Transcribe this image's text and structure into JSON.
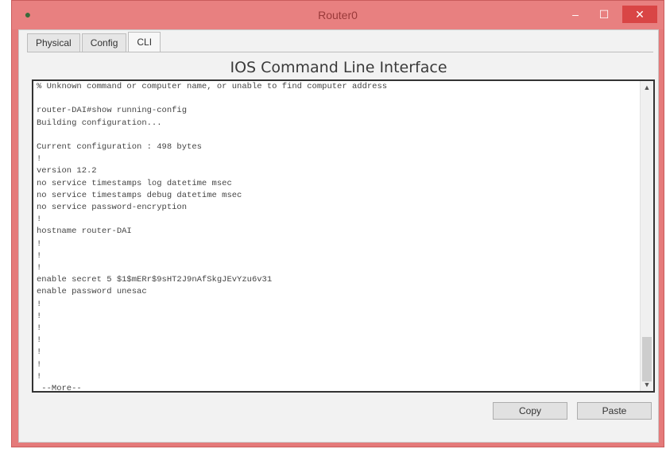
{
  "window": {
    "title": "Router0",
    "controls": {
      "minimize": "–",
      "maximize": "☐",
      "close": "✕"
    }
  },
  "tabs": [
    {
      "label": "Physical",
      "active": false
    },
    {
      "label": "Config",
      "active": false
    },
    {
      "label": "CLI",
      "active": true
    }
  ],
  "panel": {
    "title": "IOS Command Line Interface"
  },
  "terminal": {
    "lines": [
      "% Unknown command or computer name, or unable to find computer address",
      "",
      "router-DAI#show running-config",
      "Building configuration...",
      "",
      "Current configuration : 498 bytes",
      "!",
      "version 12.2",
      "no service timestamps log datetime msec",
      "no service timestamps debug datetime msec",
      "no service password-encryption",
      "!",
      "hostname router-DAI",
      "!",
      "!",
      "!",
      "enable secret 5 $1$mERr$9sHT2J9nAfSkgJEvYzu6v31",
      "enable password unesac",
      "!",
      "!",
      "!",
      "!",
      "!",
      "!",
      "!",
      " --More--"
    ]
  },
  "buttons": {
    "copy": "Copy",
    "paste": "Paste"
  },
  "icons": {
    "app": "packet-tracer-icon",
    "scroll_up": "chevron-up-icon",
    "scroll_down": "chevron-down-icon"
  },
  "colors": {
    "titlebar": "#e88080",
    "close_button": "#d94545",
    "client_bg": "#f2f2f2",
    "terminal_bg": "#ffffff",
    "terminal_border": "#333333"
  }
}
